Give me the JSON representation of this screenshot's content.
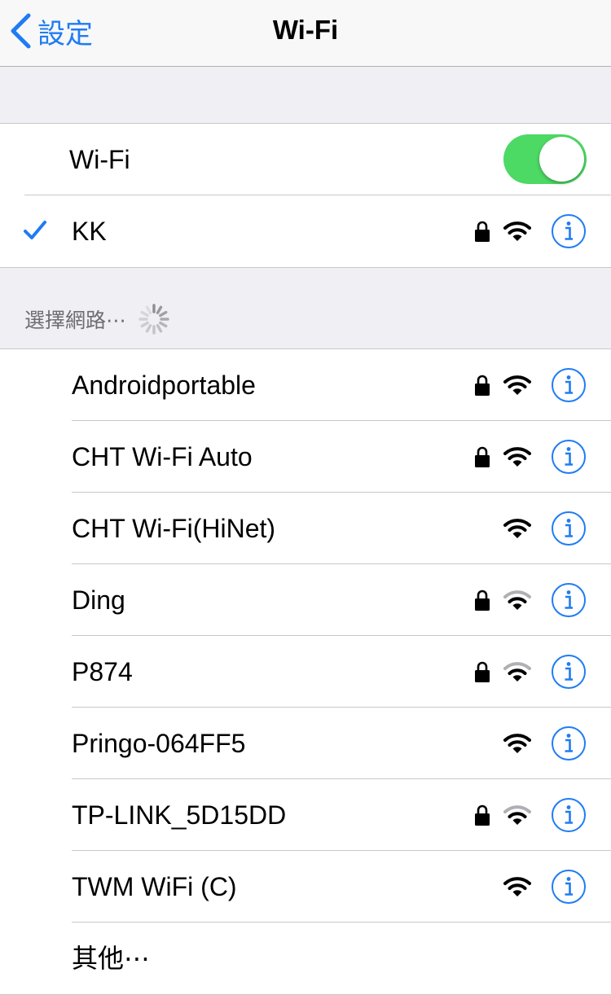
{
  "navbar": {
    "back_label": "設定",
    "title": "Wi-Fi"
  },
  "wifi_toggle": {
    "label": "Wi-Fi",
    "on": true,
    "color": "#4cd964"
  },
  "connected": {
    "name": "KK",
    "secured": true,
    "signal": "full"
  },
  "section": {
    "header": "選擇網路⋯"
  },
  "networks": [
    {
      "name": "Androidportable",
      "secured": true,
      "signal": "full"
    },
    {
      "name": "CHT Wi-Fi Auto",
      "secured": true,
      "signal": "full"
    },
    {
      "name": "CHT Wi-Fi(HiNet)",
      "secured": false,
      "signal": "full"
    },
    {
      "name": "Ding",
      "secured": true,
      "signal": "medium"
    },
    {
      "name": "P874",
      "secured": true,
      "signal": "medium"
    },
    {
      "name": "Pringo-064FF5",
      "secured": false,
      "signal": "full"
    },
    {
      "name": "TP-LINK_5D15DD",
      "secured": true,
      "signal": "medium"
    },
    {
      "name": "TWM WiFi (C)",
      "secured": false,
      "signal": "full"
    }
  ],
  "other": {
    "label": "其他⋯"
  },
  "colors": {
    "accent": "#1f7cf3",
    "background": "#efeff4",
    "separator": "#c8c7cc"
  }
}
